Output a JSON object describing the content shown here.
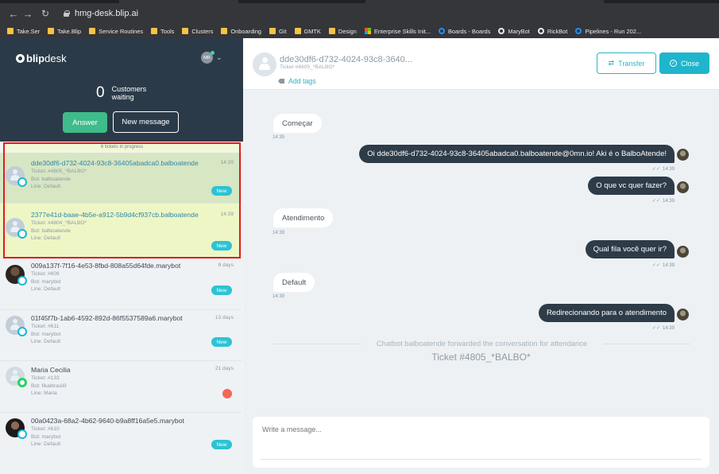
{
  "browser": {
    "url": "hmg-desk.blip.ai",
    "bookmarks": [
      {
        "label": "Take.Ser",
        "icon": "folder-icon"
      },
      {
        "label": "Take.Blip",
        "icon": "folder-icon"
      },
      {
        "label": "Service Routines",
        "icon": "folder-icon"
      },
      {
        "label": "Tools",
        "icon": "folder-icon"
      },
      {
        "label": "Clusters",
        "icon": "folder-icon"
      },
      {
        "label": "Onboarding",
        "icon": "folder-icon"
      },
      {
        "label": "Git",
        "icon": "folder-icon"
      },
      {
        "label": "GMTK",
        "icon": "folder-icon"
      },
      {
        "label": "Design",
        "icon": "folder-icon"
      },
      {
        "label": "Enterprise Skills Init...",
        "icon": "microsoft-icon"
      },
      {
        "label": "Boards - Boards",
        "icon": "azure-boards-icon"
      },
      {
        "label": "MaryBot",
        "icon": "github-icon"
      },
      {
        "label": "RickBot",
        "icon": "github-icon"
      },
      {
        "label": "Pipelines - Run 202...",
        "icon": "azure-boards-icon"
      }
    ]
  },
  "sidebar": {
    "logo_bold": "blip",
    "logo_light": "desk",
    "user_initials": "MR",
    "waiting_count": "0",
    "waiting_label": "Customers waiting",
    "answer_label": "Answer",
    "new_message_label": "New message",
    "progress_label": "6 tickets in progress",
    "tickets": [
      {
        "title": "dde30df6-d732-4024-93c8-36405abadca0.balboatende",
        "time": "14:39",
        "ticket": "Ticket: #4805_*BALBO*",
        "bot": "Bot: balboatende",
        "line": "Line: Default",
        "badge": "New"
      },
      {
        "title": "2377e41d-baae-4b5e-a912-5b9d4cf937cb.balboatende",
        "time": "14:39",
        "ticket": "Ticket: #4804_*BALBO*",
        "bot": "Bot: balboatende",
        "line": "Line: Default",
        "badge": "New"
      },
      {
        "title": "009a137f-7f16-4e53-8fbd-808a55d64fde.marybot",
        "time": "8 days",
        "ticket": "Ticket: #609",
        "bot": "Bot: marybot",
        "line": "Line: Default",
        "badge": "New"
      },
      {
        "title": "01f45f7b-1ab6-4592-892d-86f5537589a6.marybot",
        "time": "13 days",
        "ticket": "Ticket: #611",
        "bot": "Bot: marybot",
        "line": "Line: Default",
        "badge": "New"
      },
      {
        "title": "Maria Cecilia",
        "time": "21 days",
        "ticket": "Ticket: #133",
        "bot": "Bot: fikalbrasil3",
        "line": "Line: Maria",
        "badge": ""
      },
      {
        "title": "00a0423a-68a2-4b62-9640-b9a8ff16a5e5.marybot",
        "time": "",
        "ticket": "Ticket: #610",
        "bot": "Bot: marybot",
        "line": "Line: Default",
        "badge": "New"
      }
    ]
  },
  "header": {
    "name": "dde30df6-d732-4024-93c8-3640...",
    "ticket": "Ticket #4805_*BALBO*",
    "add_tags": "Add tags",
    "transfer": "Transfer",
    "close": "Close"
  },
  "messages": [
    {
      "dir": "in",
      "text": "Começar",
      "time": "14:39"
    },
    {
      "dir": "out",
      "text": "Oi dde30df6-d732-4024-93c8-36405abadca0.balboatende@0mn.io! Aki é o BalboAtende!",
      "time": "14:39"
    },
    {
      "dir": "out",
      "text": "O que vc quer fazer?",
      "time": "14:39"
    },
    {
      "dir": "in",
      "text": "Atendimento",
      "time": "14:39"
    },
    {
      "dir": "out",
      "text": "Qual fila você quer ir?",
      "time": "14:39"
    },
    {
      "dir": "in",
      "text": "Default",
      "time": "14:39"
    },
    {
      "dir": "out",
      "text": "Redirecionando para o atendimento",
      "time": "14:39"
    }
  ],
  "forwarded": "Chatbot balboatende forwarded the conversation for attendance",
  "ticket_ref": "Ticket #4805_*BALBO*",
  "composer": {
    "placeholder": "Write a message..."
  },
  "colors": {
    "sidebar_dark": "#2b3a48",
    "accent": "#1fb5cc",
    "answer_green": "#3ebc8a",
    "bubble_out": "#2e3b48",
    "highlight_red": "#e11b22"
  }
}
